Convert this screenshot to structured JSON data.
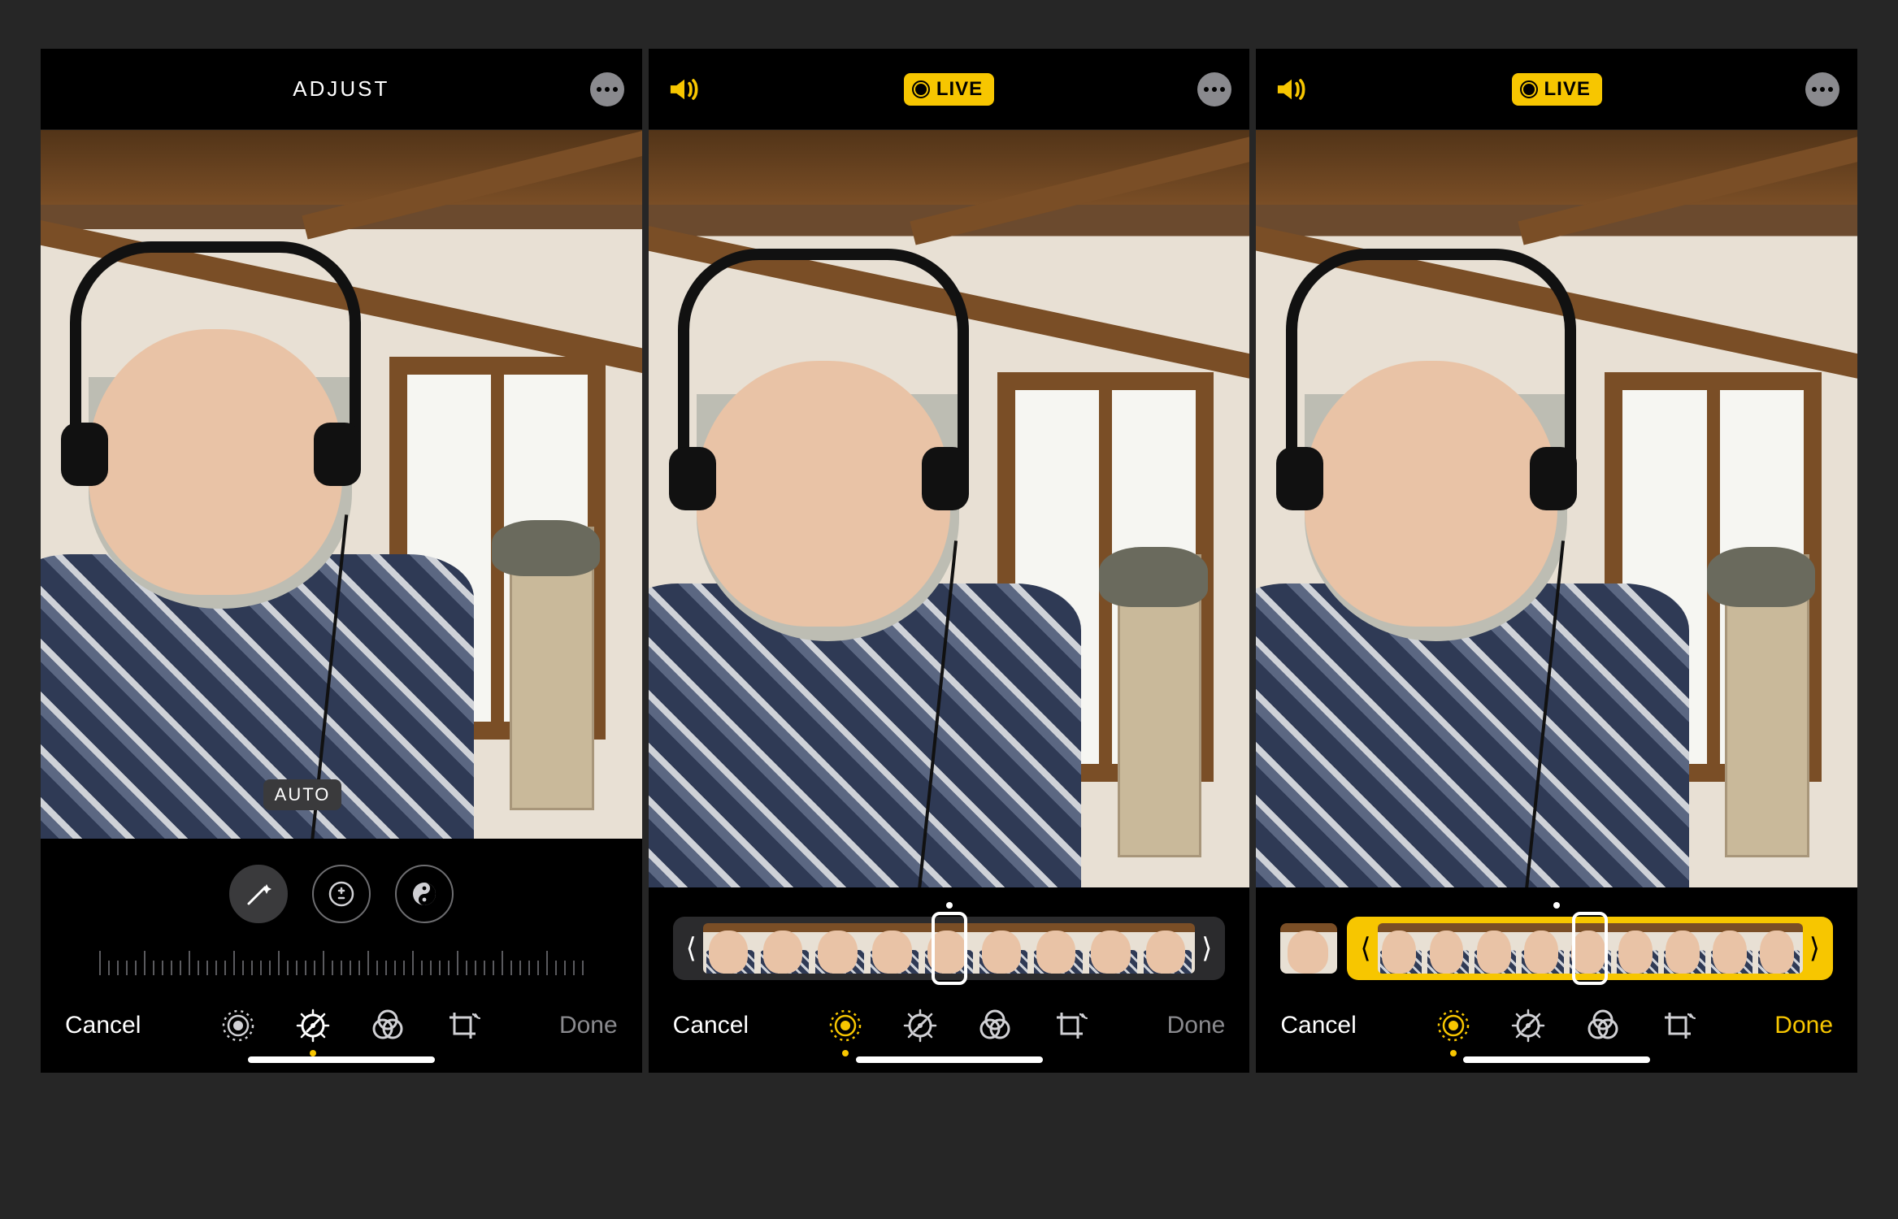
{
  "colors": {
    "accent": "#f7c600",
    "muted": "#8a8a8e"
  },
  "screens": [
    {
      "id": "adjust",
      "top": {
        "kind": "title",
        "title": "ADJUST"
      },
      "overlay": {
        "auto_label": "AUTO"
      },
      "mid": {
        "kind": "dials"
      },
      "toolbar": {
        "cancel": "Cancel",
        "done": "Done",
        "done_active": false,
        "selected": "adjust"
      }
    },
    {
      "id": "live-1",
      "top": {
        "kind": "live",
        "live_label": "LIVE"
      },
      "mid": {
        "kind": "filmstrip",
        "selection": "none"
      },
      "toolbar": {
        "cancel": "Cancel",
        "done": "Done",
        "done_active": false,
        "selected": "live"
      }
    },
    {
      "id": "live-2",
      "top": {
        "kind": "live",
        "live_label": "LIVE"
      },
      "mid": {
        "kind": "filmstrip",
        "selection": "yellow"
      },
      "toolbar": {
        "cancel": "Cancel",
        "done": "Done",
        "done_active": true,
        "selected": "live"
      }
    }
  ],
  "toolbar_icons": [
    "live",
    "adjust",
    "filters",
    "crop"
  ]
}
